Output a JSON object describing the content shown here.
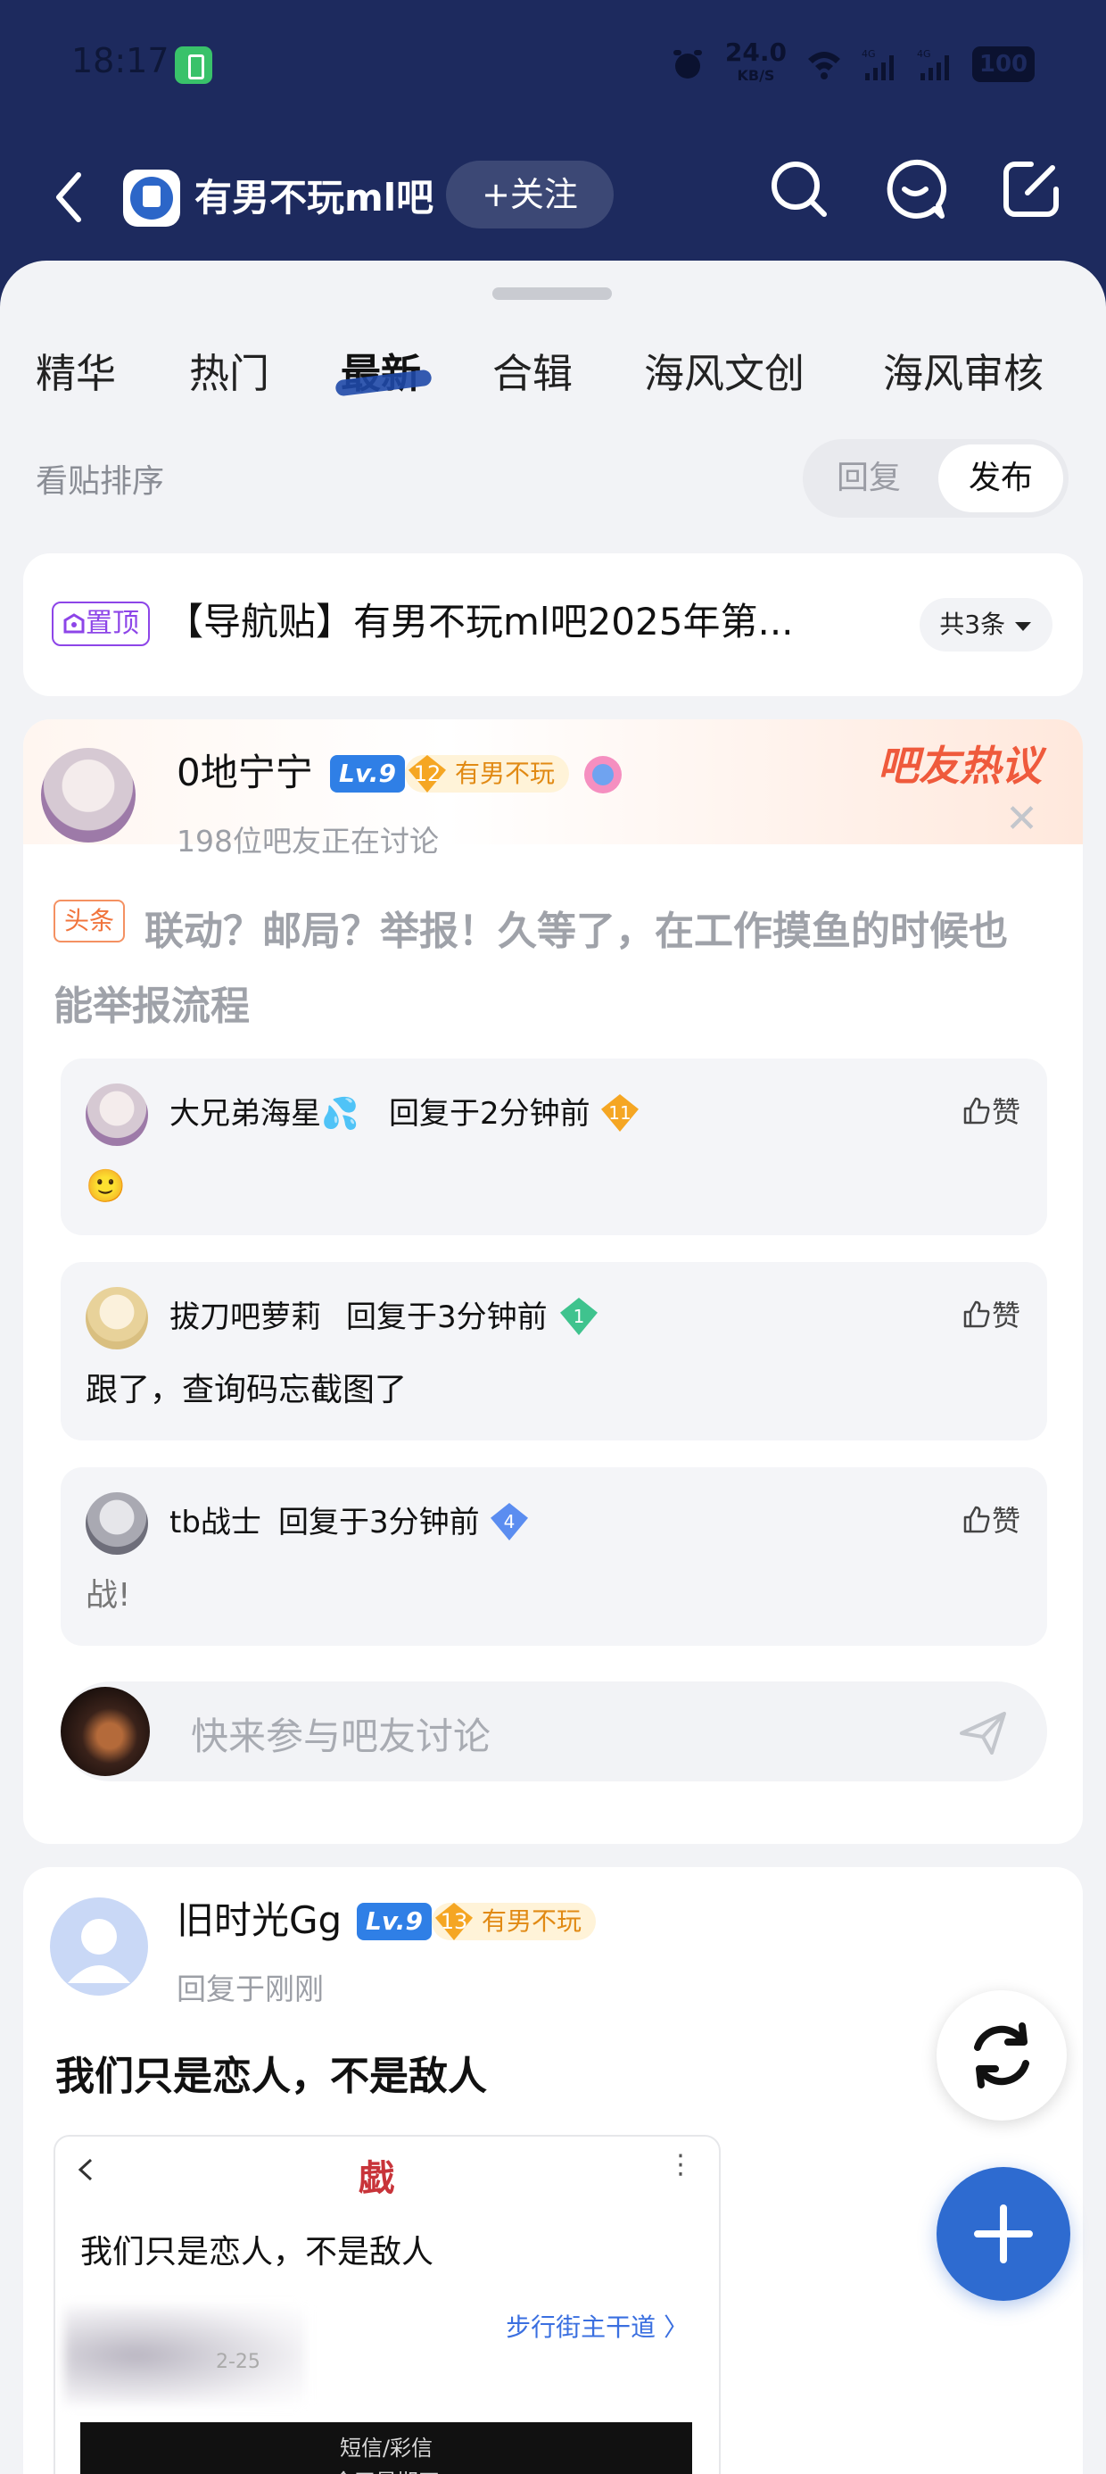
{
  "status_bar": {
    "time": "18:17",
    "net_speed": "24.0",
    "net_unit": "KB/S",
    "signal1": "4G",
    "signal2": "4G",
    "battery": "100"
  },
  "header": {
    "bar_name": "有男不玩ml吧",
    "follow_label": "+关注",
    "icons": [
      "back-icon",
      "search-icon",
      "message-icon",
      "compose-icon"
    ]
  },
  "tabs": [
    "精华",
    "热门",
    "最新",
    "合辑",
    "海风文创",
    "海风审核"
  ],
  "active_tab": "最新",
  "sort": {
    "label": "看贴排序",
    "reply": "回复",
    "publish": "发布"
  },
  "pinned": {
    "tag": "置顶",
    "title": "【导航贴】有男不玩ml吧2025年第...",
    "count": "共3条"
  },
  "hot_discussion": {
    "label": "吧友热议",
    "user": "0地宁宁",
    "level": "Lv.9",
    "fan_level": "12",
    "fan_name": "有男不玩",
    "sub": "198位吧友正在讨论",
    "headline_tag": "头条",
    "headline": "联动？邮局？举报！久等了，在工作摸鱼的时候也能举报流程",
    "replies": [
      {
        "name": "大兄弟海星💦",
        "time": "回复于2分钟前",
        "gem": "11",
        "like": "赞",
        "text": "🙂"
      },
      {
        "name": "拔刀吧萝莉",
        "time": "回复于3分钟前",
        "gem": "1",
        "like": "赞",
        "text": "跟了，查询码忘截图了"
      },
      {
        "name": "tb战士",
        "time": "回复于3分钟前",
        "gem": "4",
        "like": "赞",
        "text": "战!"
      }
    ],
    "input_placeholder": "快来参与吧友讨论"
  },
  "post": {
    "user": "旧时光Gg",
    "level": "Lv.9",
    "fan_level": "13",
    "fan_name": "有男不玩",
    "sub": "回复于刚刚",
    "title": "我们只是恋人，不是敌人",
    "shot": {
      "brand": "戯",
      "title": "我们只是恋人，不是敌人",
      "link": "步行街主干道 〉",
      "date": "2-25",
      "dark_line1": "短信/彩信",
      "dark_line2": "今天星期四"
    }
  },
  "colors": {
    "header_bg": "#1d2a5e",
    "accent": "#2e6bd0",
    "hot": "#ef5a3c"
  }
}
